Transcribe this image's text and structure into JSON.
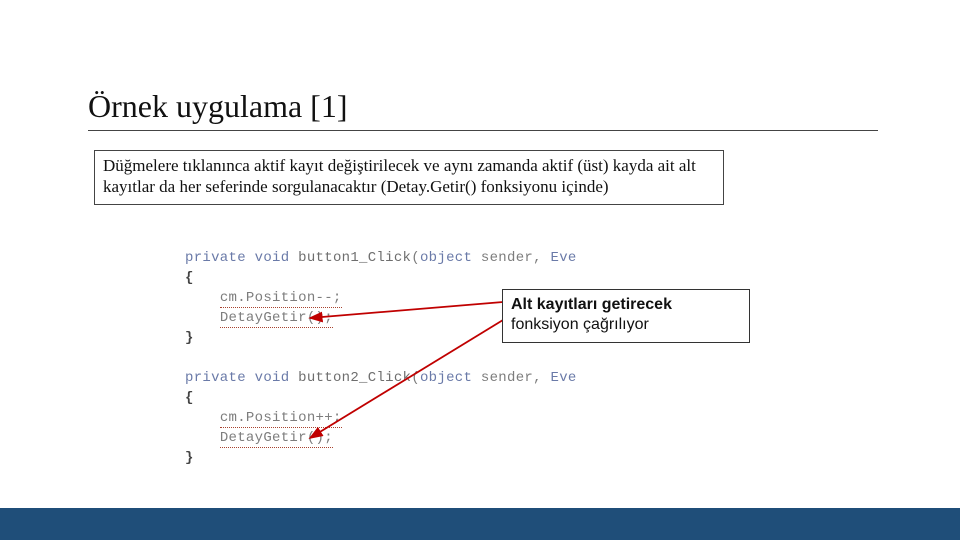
{
  "title": "Örnek uygulama [1]",
  "description": "Düğmelere tıklanınca aktif kayıt değiştirilecek ve aynı zamanda aktif (üst) kayda ait alt kayıtlar da her seferinde sorgulanacaktır (Detay.Getir() fonksiyonu içinde)",
  "callout_line1": "Alt kayıtları getirecek",
  "callout_line2": "fonksiyon çağrılıyor",
  "code": {
    "kw_private": "private",
    "kw_void": "void",
    "fn1_name": "button1_Click",
    "fn2_name": "button2_Click",
    "params_prefix": "(",
    "type_object": "object",
    "params_mid": " sender, ",
    "type_eve": "Eve",
    "brace_open": "{",
    "brace_close": "}",
    "stmt_pos_dec": "cm.Position--;",
    "stmt_pos_inc": "cm.Position++;",
    "stmt_detay": "DetayGetir();"
  }
}
